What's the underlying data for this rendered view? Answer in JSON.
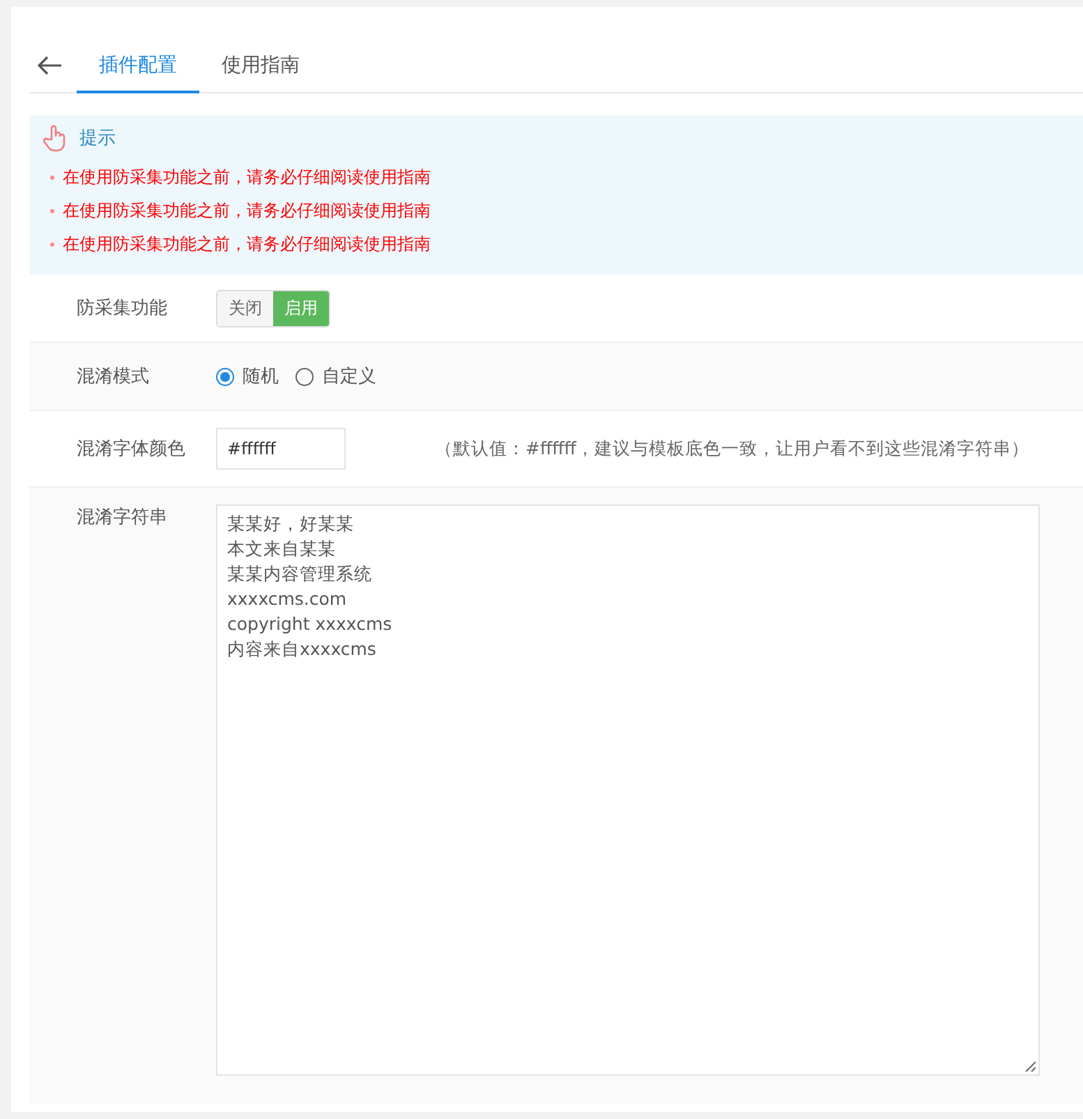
{
  "tabs": [
    {
      "label": "插件配置",
      "selected": true
    },
    {
      "label": "使用指南",
      "selected": false
    }
  ],
  "notice": {
    "title": "提示",
    "items": [
      "在使用防采集功能之前，请务必仔细阅读使用指南",
      "在使用防采集功能之前，请务必仔细阅读使用指南",
      "在使用防采集功能之前，请务必仔细阅读使用指南"
    ]
  },
  "form": [
    {
      "kind": "toggle",
      "label": "防采集功能",
      "options": [
        {
          "label": "关闭",
          "selected": false
        },
        {
          "label": "启用",
          "selected": true
        }
      ]
    },
    {
      "kind": "radio",
      "label": "混淆模式",
      "options": [
        {
          "label": "随机",
          "selected": true
        },
        {
          "label": "自定义",
          "selected": false
        }
      ]
    },
    {
      "kind": "text",
      "label": "混淆字体颜色",
      "value": "#ffffff",
      "hint": "（默认值：#ffffff，建议与模板底色一致，让用户看不到这些混淆字符串）"
    },
    {
      "kind": "textarea",
      "label": "混淆字符串",
      "lines": [
        "某某好，好某某",
        "本文来自某某",
        "某某内容管理系统",
        "xxxxcms.com",
        "copyright xxxxcms",
        "内容来自xxxxcms"
      ]
    }
  ]
}
